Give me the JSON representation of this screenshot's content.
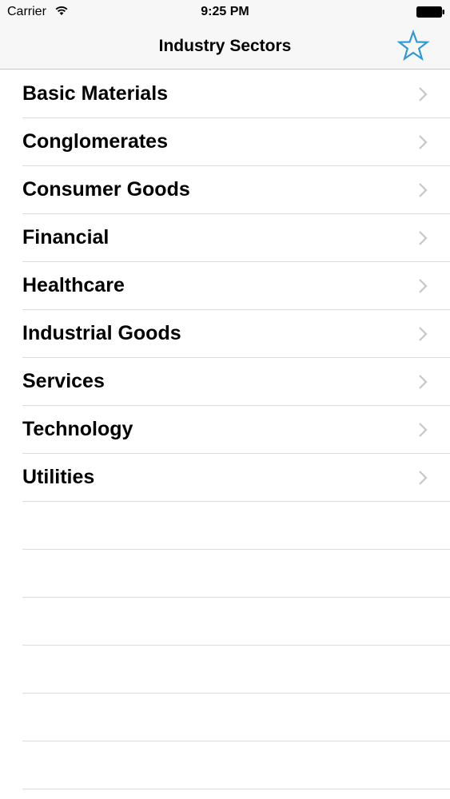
{
  "status_bar": {
    "carrier": "Carrier",
    "time": "9:25 PM",
    "wifi_icon": "wifi-icon",
    "battery_icon": "battery-icon"
  },
  "nav": {
    "title": "Industry Sectors",
    "favorites_icon": "star-icon",
    "tint_color": "#2d9ad4"
  },
  "sectors": [
    {
      "label": "Basic Materials"
    },
    {
      "label": "Conglomerates"
    },
    {
      "label": "Consumer Goods"
    },
    {
      "label": "Financial"
    },
    {
      "label": "Healthcare"
    },
    {
      "label": "Industrial Goods"
    },
    {
      "label": "Services"
    },
    {
      "label": "Technology"
    },
    {
      "label": "Utilities"
    }
  ],
  "accessory_icon": "chevron-right-icon",
  "colors": {
    "separator": "#dcdcdf",
    "nav_background": "#f7f7f7",
    "chevron": "#c7c7cc"
  }
}
